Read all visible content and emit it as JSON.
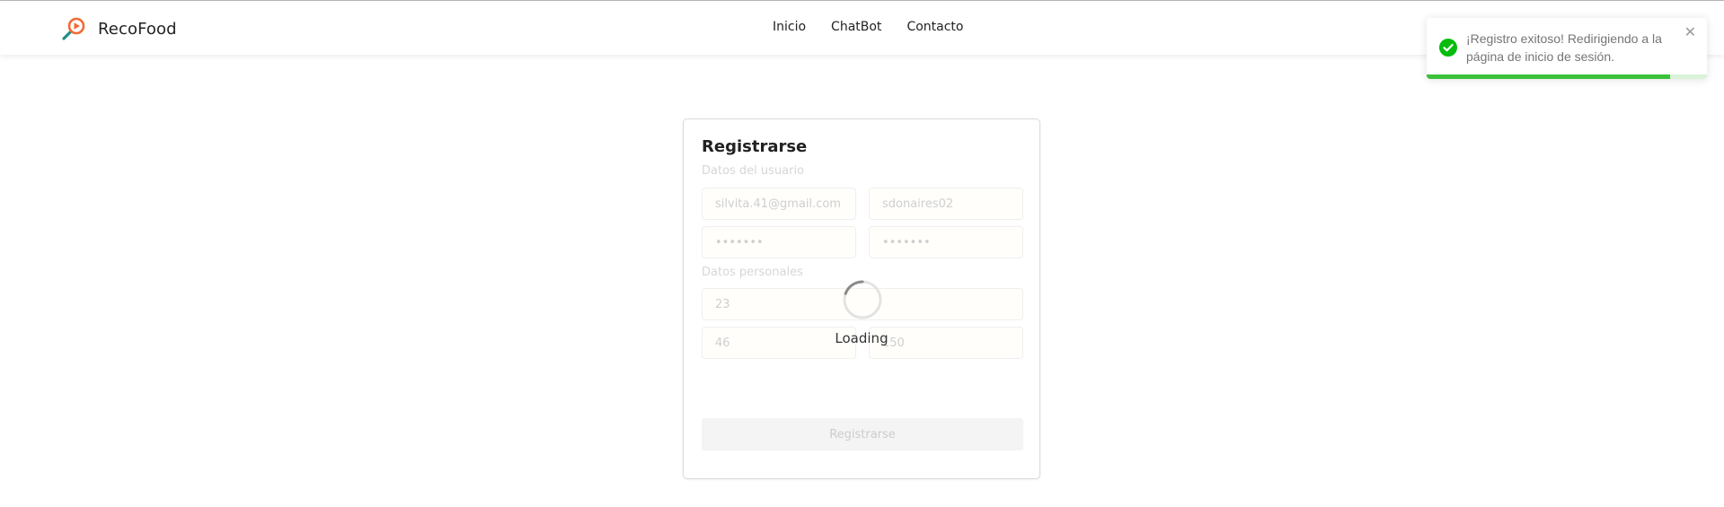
{
  "app": {
    "name": "RecoFood",
    "logo_icon": "magnifier-play-icon"
  },
  "nav": {
    "items": [
      {
        "label": "Inicio"
      },
      {
        "label": "ChatBot"
      },
      {
        "label": "Contacto"
      }
    ]
  },
  "form": {
    "title": "Registrarse",
    "user_section": "Datos del usuario",
    "personal_section": "Datos personales",
    "email": "silvita.41@gmail.com",
    "username": "sdonaires02",
    "password": "•••••••",
    "password_confirm": "•••••••",
    "age": "23",
    "weight": "46",
    "height": "150",
    "submit_label": "Registrarse"
  },
  "loading": {
    "text": "Loading"
  },
  "toast": {
    "message": "¡Registro exitoso! Redirigiendo a la página de inicio de sesión.",
    "status_icon": "check-circle-icon",
    "close_icon": "close-icon",
    "progress_fraction": 0.87,
    "accent_color": "#3cc13b"
  }
}
